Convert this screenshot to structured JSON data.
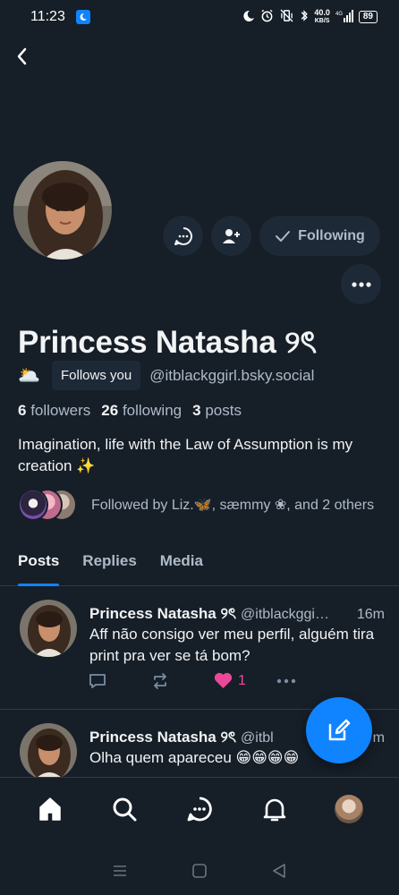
{
  "status_bar": {
    "time": "11:23",
    "net_speed_value": "40.0",
    "net_speed_unit": "KB/S",
    "battery": "89"
  },
  "profile": {
    "display_name": "Princess Natasha ୨ৎ",
    "sun_emoji": "🌥️",
    "follows_you_label": "Follows you",
    "handle": "@itblackggirl.bsky.social",
    "followers_count": "6",
    "followers_label": "followers",
    "following_count": "26",
    "following_label": "following",
    "posts_count": "3",
    "posts_label": "posts",
    "bio": "Imagination, life with the Law of Assumption is my creation ✨",
    "followed_by": "Followed by Liz.🦋, sæmmy ❀, and 2 others",
    "following_button_label": "Following"
  },
  "tabs": [
    {
      "label": "Posts",
      "active": true
    },
    {
      "label": "Replies",
      "active": false
    },
    {
      "label": "Media",
      "active": false
    }
  ],
  "posts": [
    {
      "name": "Princess Natasha ୨ৎ",
      "handle": "@itblackggi…",
      "time": "16m",
      "text": "Aff não consigo ver meu perfil, alguém tira print pra ver se tá bom?",
      "like_count": "1"
    },
    {
      "name": "Princess Natasha ୨ৎ",
      "handle": "@itbl",
      "time": "m",
      "text": "Olha quem apareceu 😁😁😁😁"
    }
  ],
  "colors": {
    "background": "#161e27",
    "surface": "#1e2937",
    "accent": "#1083fe",
    "like": "#ec4899",
    "muted_text": "#aebbc9"
  }
}
